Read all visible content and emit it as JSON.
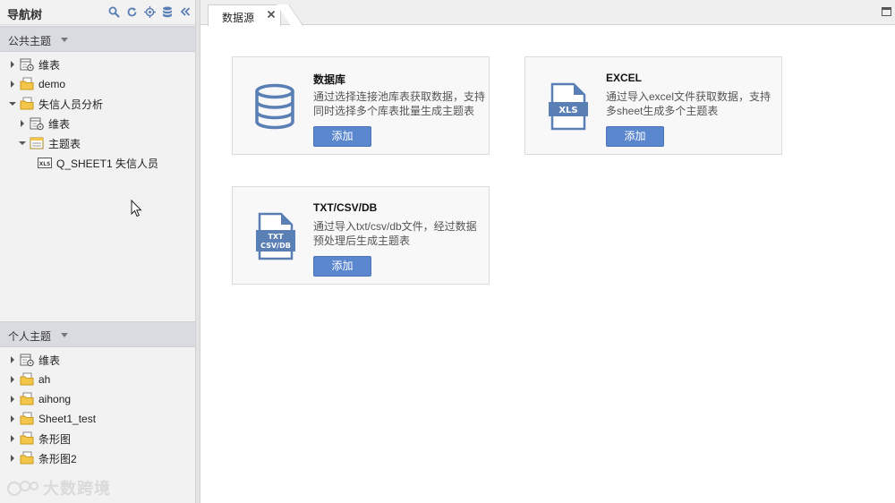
{
  "nav": {
    "title": "导航树",
    "public_section": {
      "label": "公共主题",
      "items": [
        {
          "label": "维表",
          "icon": "dimension-icon",
          "level": 0,
          "expanded": false
        },
        {
          "label": "demo",
          "icon": "folder-icon",
          "level": 0,
          "expanded": false
        },
        {
          "label": "失信人员分析",
          "icon": "folder-icon",
          "level": 0,
          "expanded": true
        },
        {
          "label": "维表",
          "icon": "dimension-icon",
          "level": 1,
          "expanded": false
        },
        {
          "label": "主题表",
          "icon": "subject-table-icon",
          "level": 1,
          "expanded": true
        },
        {
          "label": "Q_SHEET1 失信人员",
          "icon": "xls-icon",
          "level": 2,
          "expanded": null
        }
      ]
    },
    "personal_section": {
      "label": "个人主题",
      "items": [
        {
          "label": "维表",
          "icon": "dimension-icon",
          "level": 0,
          "expanded": false
        },
        {
          "label": "ah",
          "icon": "folder-icon",
          "level": 0,
          "expanded": false
        },
        {
          "label": "aihong",
          "icon": "folder-icon",
          "level": 0,
          "expanded": false
        },
        {
          "label": "Sheet1_test",
          "icon": "folder-icon",
          "level": 0,
          "expanded": false
        },
        {
          "label": "条形图",
          "icon": "folder-icon",
          "level": 0,
          "expanded": false
        },
        {
          "label": "条形图2",
          "icon": "folder-icon",
          "level": 0,
          "expanded": false
        }
      ]
    }
  },
  "tab": {
    "label": "数据源"
  },
  "cards": {
    "db": {
      "title": "数据库",
      "desc1": "通过选择连接池库表获取数据，支持",
      "desc2": "同时选择多个库表批量生成主题表",
      "button": "添加"
    },
    "excel": {
      "title": "EXCEL",
      "desc1": "通过导入excel文件获取数据，支持",
      "desc2": "多sheet生成多个主题表",
      "button": "添加",
      "icon_text": "XLS"
    },
    "txt": {
      "title": "TXT/CSV/DB",
      "desc1": "通过导入txt/csv/db文件，经过数据",
      "desc2": "预处理后生成主题表",
      "button": "添加",
      "icon_text1": "TXT",
      "icon_text2": "CSV/DB"
    }
  },
  "watermark": {
    "text": "大数跨境"
  },
  "colors": {
    "accent": "#5b87cf",
    "icon_blue": "#5a7fb5",
    "folder_yellow": "#f3c64a",
    "section_bar": "#d9dbe0"
  }
}
